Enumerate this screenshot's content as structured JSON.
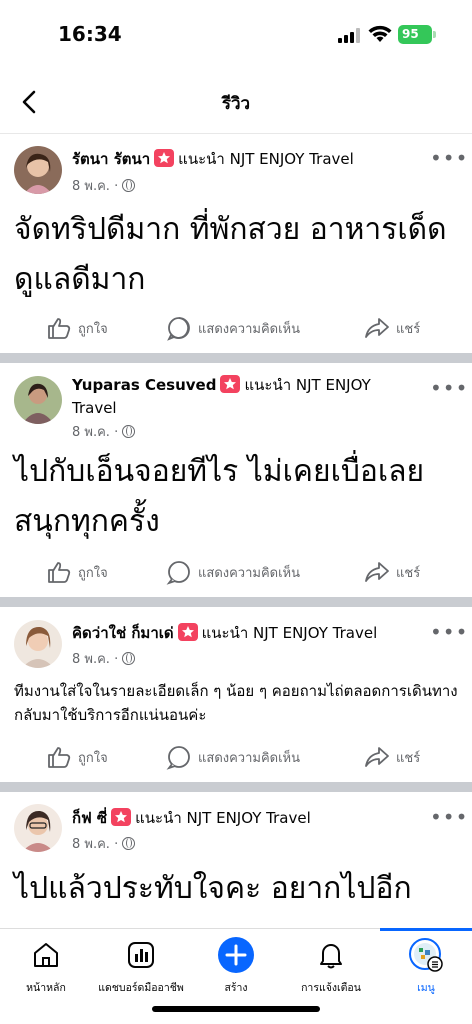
{
  "status_bar": {
    "time": "16:34",
    "battery": "95"
  },
  "header": {
    "title": "รีวิว"
  },
  "posts": [
    {
      "author": "รัตนา รัตนา",
      "recommend_text": "แนะนำ NJT ENJOY Travel",
      "date": "8 พ.ค. ·",
      "text": "จัดทริปดีมาก ที่พักสวย อาหารเด็ด ดูแลดีมาก"
    },
    {
      "author": "Yuparas Cesuved",
      "recommend_text": "แนะนำ NJT ENJOY Travel",
      "date": "8 พ.ค. ·",
      "text": "ไปกับเอ็นจอยทีไร ไม่เคยเบื่อเลย สนุกทุกครั้ง"
    },
    {
      "author": "คิดว่าใช่ ก็มาเด่",
      "recommend_text": "แนะนำ NJT ENJOY Travel",
      "date": "8 พ.ค. ·",
      "text": "ทีมงานใส่ใจในรายละเอียดเล็ก ๆ น้อย ๆ คอยถามไถ่ตลอดการเดินทาง กลับมาใช้บริการอีกแน่นอนค่ะ"
    },
    {
      "author": "ก็ฟ ซี่",
      "recommend_text": "แนะนำ NJT ENJOY Travel",
      "date": "8 พ.ค. ·",
      "text": "ไปแล้วประทับใจคะ อยากไปอีก"
    }
  ],
  "actions": {
    "like": "ถูกใจ",
    "comment": "แสดงความคิดเห็น",
    "share": "แชร์"
  },
  "nav": {
    "home": "หน้าหลัก",
    "dashboard": "แดชบอร์ดมืออาชีพ",
    "create": "สร้าง",
    "notifications": "การแจ้งเตือน",
    "menu": "เมนู"
  },
  "colors": {
    "accent": "#0866ff",
    "divider": "#c9ccd1",
    "badge": "#f3425f",
    "secondary_text": "#65676b"
  }
}
